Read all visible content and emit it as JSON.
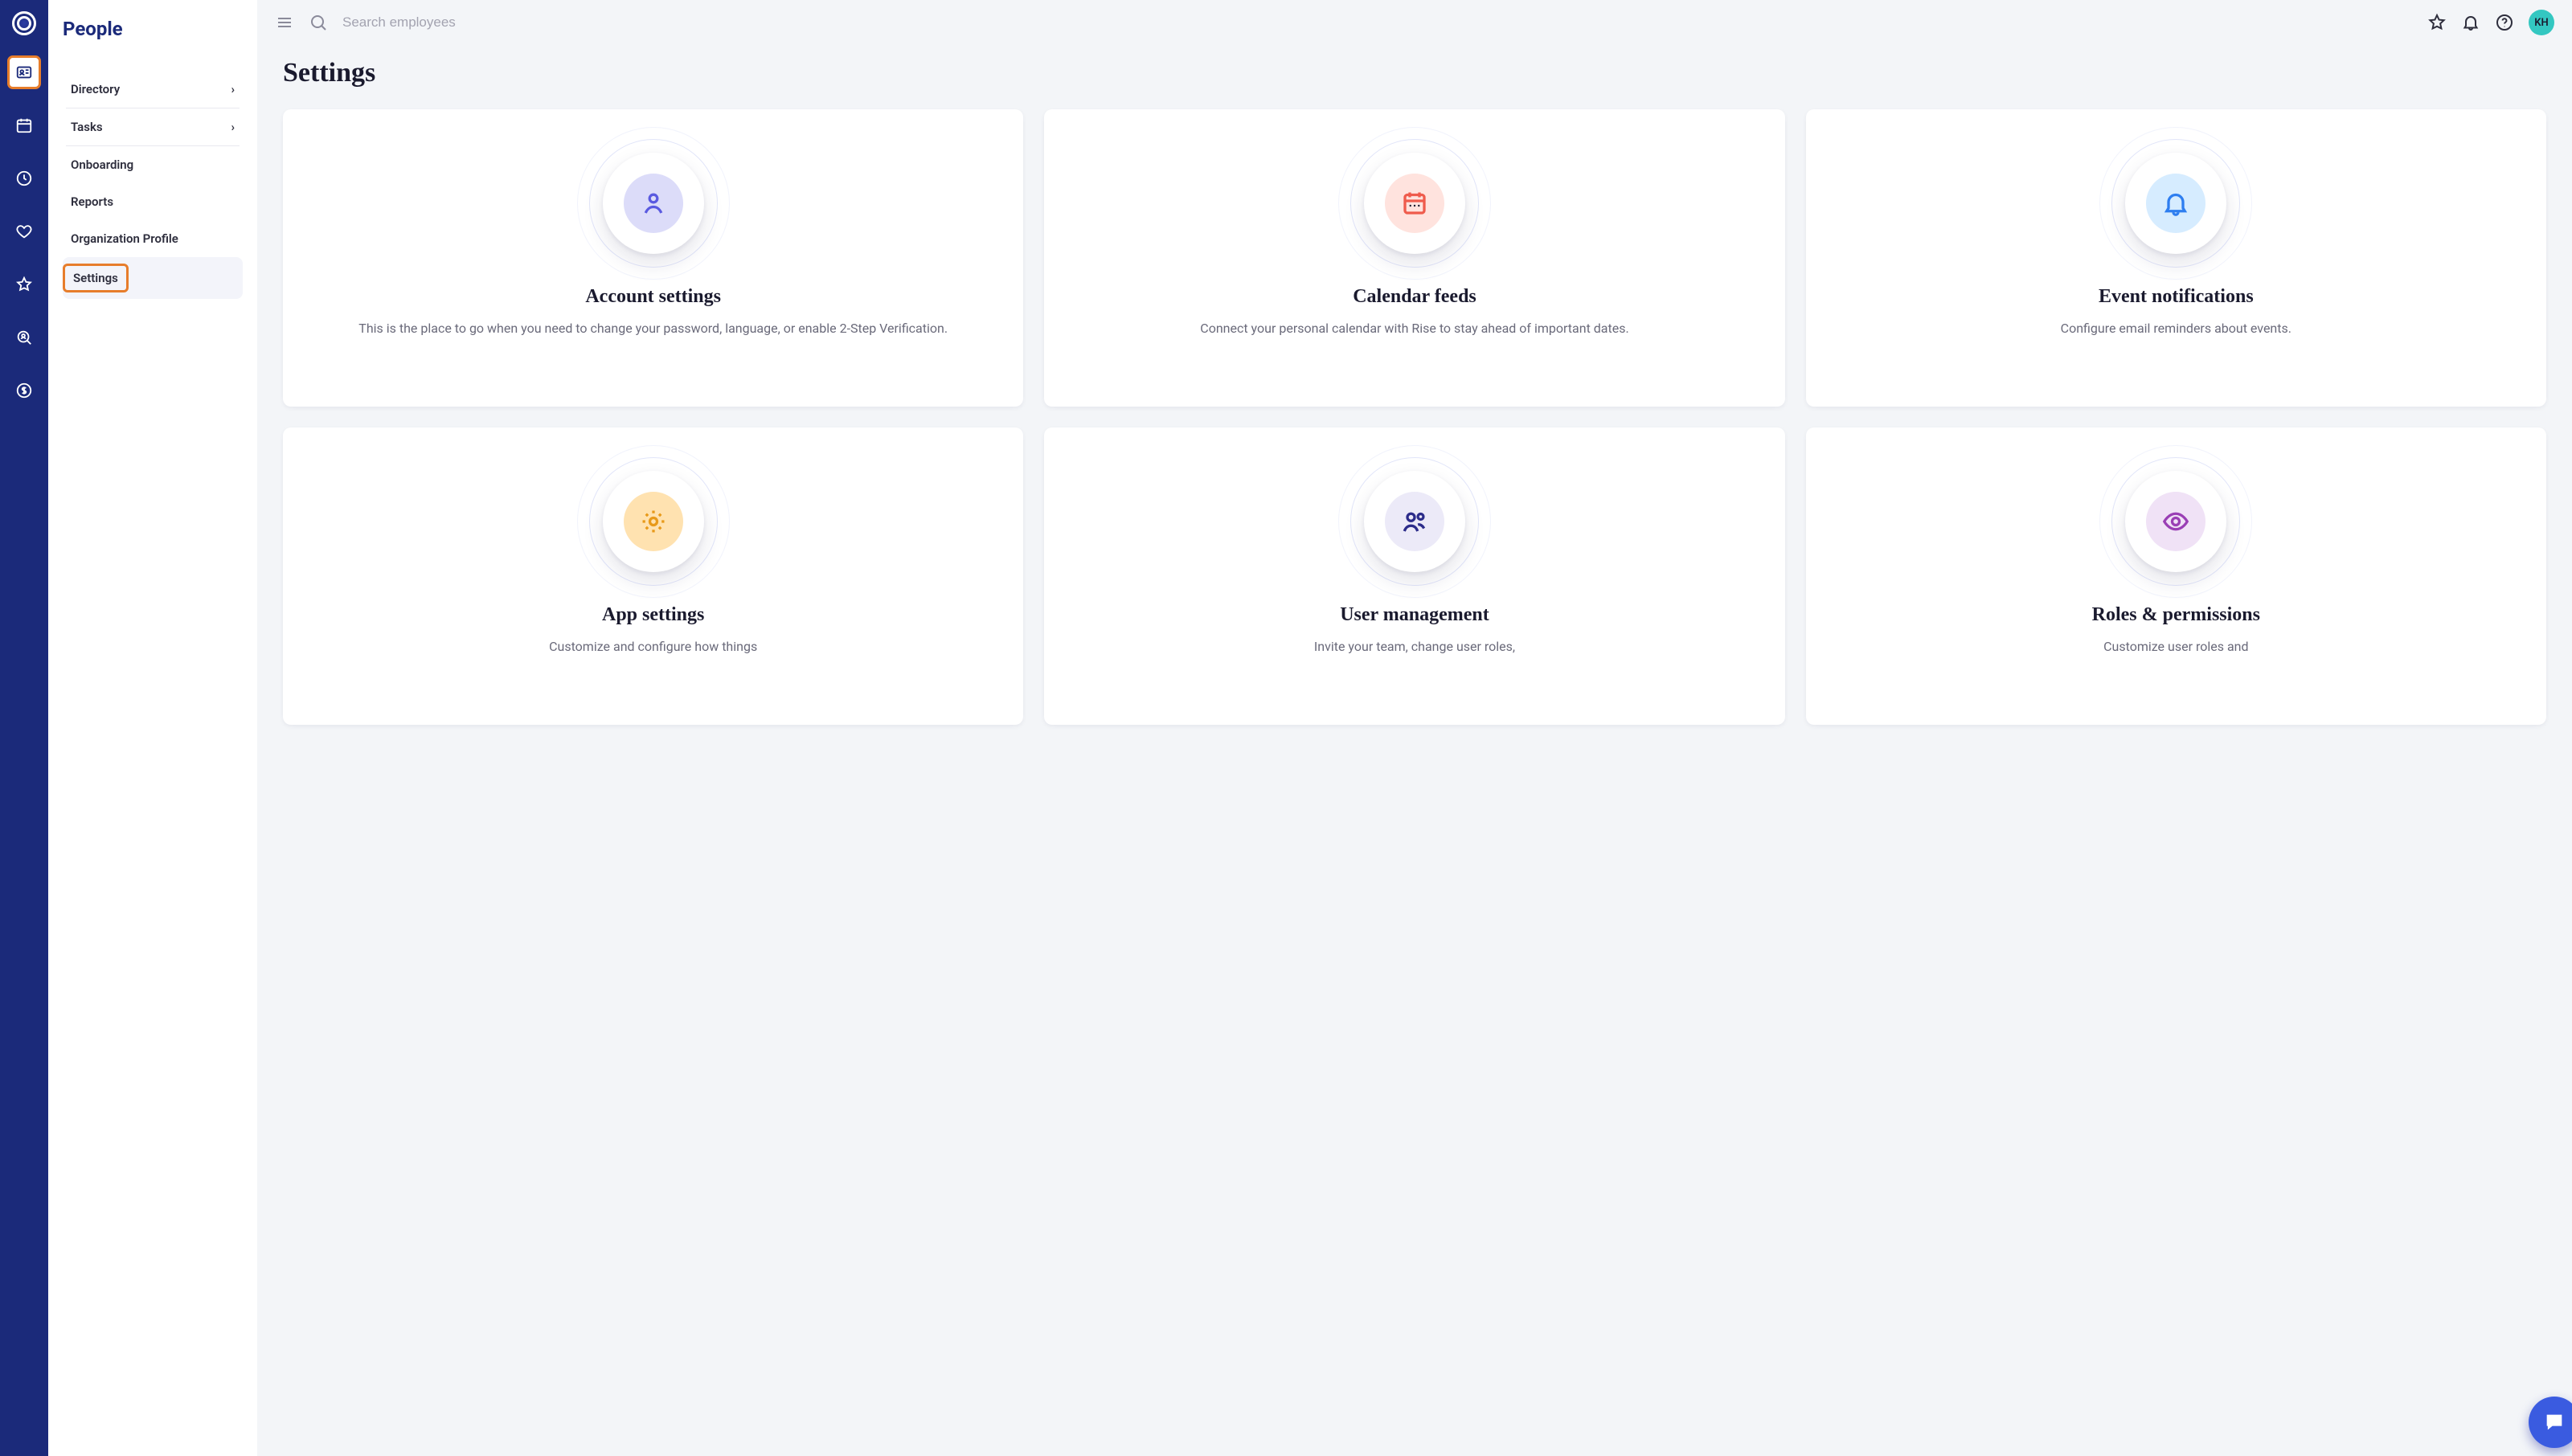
{
  "section_title": "People",
  "sidebar": {
    "items": [
      {
        "label": "Directory",
        "has_chevron": true
      },
      {
        "label": "Tasks",
        "has_chevron": true
      },
      {
        "label": "Onboarding",
        "has_chevron": false
      },
      {
        "label": "Reports",
        "has_chevron": false
      },
      {
        "label": "Organization Profile",
        "has_chevron": false
      },
      {
        "label": "Settings",
        "has_chevron": false,
        "active": true
      }
    ]
  },
  "search": {
    "placeholder": "Search employees"
  },
  "user": {
    "initials": "KH"
  },
  "page": {
    "title": "Settings"
  },
  "cards": [
    {
      "title": "Account settings",
      "desc": "This is the place to go when you need to change your password, language, or enable 2-Step Verification."
    },
    {
      "title": "Calendar feeds",
      "desc": "Connect your personal calendar with Rise to stay ahead of important dates."
    },
    {
      "title": "Event notifications",
      "desc": "Configure email reminders about events."
    },
    {
      "title": "App settings",
      "desc": "Customize and configure how things"
    },
    {
      "title": "User management",
      "desc": "Invite your team, change user roles,"
    },
    {
      "title": "Roles & permissions",
      "desc": "Customize user roles and"
    }
  ]
}
